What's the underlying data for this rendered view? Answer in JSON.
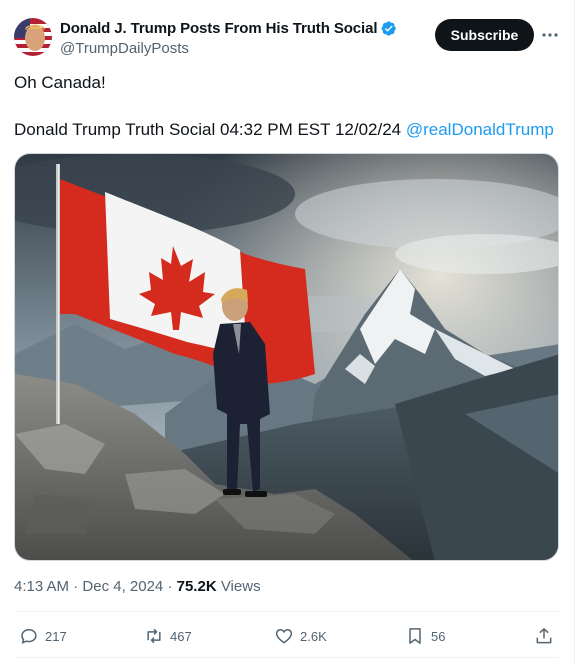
{
  "account": {
    "display_name": "Donald J. Trump Posts From His Truth Social",
    "handle": "@TrumpDailyPosts",
    "verified": true,
    "verified_color": "#1d9bf0"
  },
  "header": {
    "subscribe_label": "Subscribe",
    "more_icon": "more-horizontal-icon"
  },
  "post": {
    "line1": "Oh Canada!",
    "line2": "Donald Trump Truth Social 04:32 PM EST 12/02/24",
    "mention": "@realDonaldTrump",
    "mention_color": "#1d9bf0"
  },
  "meta": {
    "time": "4:13 AM",
    "date": "Dec 4, 2024",
    "views_count": "75.2K",
    "views_label": "Views"
  },
  "actions": {
    "replies": "217",
    "reposts": "467",
    "likes": "2.6K",
    "bookmarks": "56"
  }
}
